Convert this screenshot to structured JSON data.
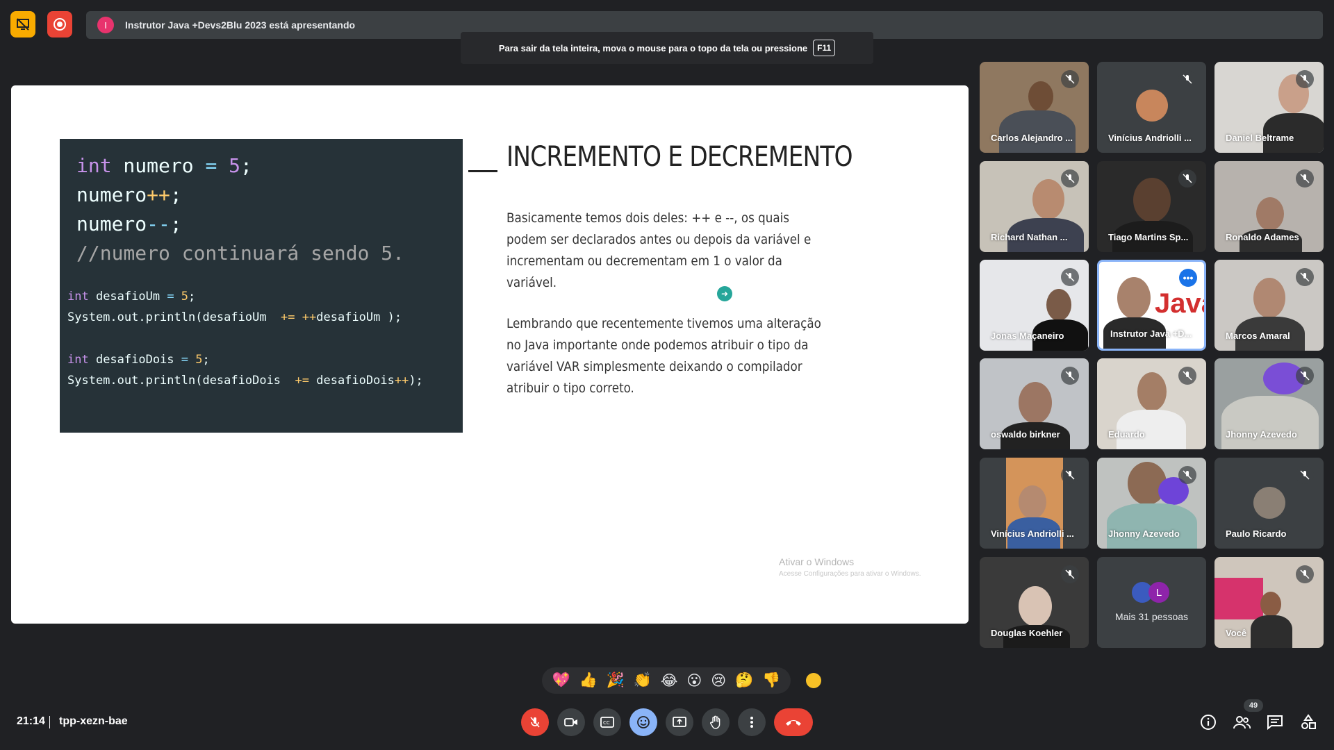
{
  "topbar": {
    "presentation_text": "Instrutor Java +Devs2Blu 2023 está apresentando",
    "presenter_initial": "I",
    "fullscreen_tip": "Para sair da tela inteira, mova o mouse para o topo da tela ou pressione",
    "fullscreen_key": "F11"
  },
  "slide": {
    "code_big": {
      "l1_kw": "int",
      "l1_var": " numero ",
      "l1_eq": "=",
      "l1_num": " 5",
      "l1_end": ";",
      "l2_var": "numero",
      "l2_op": "++",
      "l2_end": ";",
      "l3_var": "numero",
      "l3_op": "--",
      "l3_end": ";",
      "l4_comment": "//numero continuará sendo 5."
    },
    "code_small": {
      "l1_kw": "int",
      "l1_rest": " desafioUm ",
      "l1_eq": "=",
      "l1_num": " 5",
      "l1_end": ";",
      "l2_a": "System.out.println(desafioUm  ",
      "l2_op": "+=",
      "l2_b": " ",
      "l2_op2": "++",
      "l2_c": "desafioUm );",
      "l3_kw": "int",
      "l3_rest": " desafioDois ",
      "l3_eq": "=",
      "l3_num": " 5",
      "l3_end": ";",
      "l4_a": "System.out.println(desafioDois  ",
      "l4_op": "+=",
      "l4_b": " desafioDois",
      "l4_op2": "++",
      "l4_c": ");"
    },
    "title": "INCREMENTO E DECREMENTO",
    "paragraph1": "Basicamente temos dois deles: ++ e --, os quais podem ser declarados antes ou depois da variável e incrementam ou decrementam em 1 o valor da variável.",
    "paragraph2": "Lembrando que recentemente tivemos uma alteração no Java importante onde podemos atribuir o tipo da variável VAR simplesmente deixando o compilador atribuir o tipo correto.",
    "watermark_title": "Ativar o Windows",
    "watermark_sub": "Acesse Configurações para ativar o Windows."
  },
  "participants": [
    {
      "name": "Carlos Alejandro ..."
    },
    {
      "name": "Vinícius Andriolli ..."
    },
    {
      "name": "Daniel Beltrame"
    },
    {
      "name": "Richard Nathan ..."
    },
    {
      "name": "Tiago Martins Sp..."
    },
    {
      "name": "Ronaldo Adames"
    },
    {
      "name": "Jonas Maçaneiro"
    },
    {
      "name": "Instrutor Java +D..."
    },
    {
      "name": "Marcos Amaral"
    },
    {
      "name": "oswaldo birkner"
    },
    {
      "name": "Eduardo"
    },
    {
      "name": "Jhonny Azevedo"
    },
    {
      "name": "Vinícius Andriolli ..."
    },
    {
      "name": "Jhonny Azevedo"
    },
    {
      "name": "Paulo Ricardo"
    },
    {
      "name": "Douglas Koehler"
    },
    {
      "name": "Mais 31 pessoas"
    },
    {
      "name": "Você"
    }
  ],
  "more_tile": {
    "avatar_letter": "L"
  },
  "instructor_tile_text": "Java",
  "reactions": [
    "💖",
    "👍",
    "🎉",
    "👏",
    "😂",
    "😮",
    "😢",
    "🤔",
    "👎"
  ],
  "meeting": {
    "time": "21:14",
    "code": "tpp-xezn-bae",
    "participant_count": "49"
  },
  "colors": {
    "background": "#202124",
    "end_call": "#ea4335",
    "active_border": "#8ab4f8",
    "code_bg": "#263238"
  }
}
